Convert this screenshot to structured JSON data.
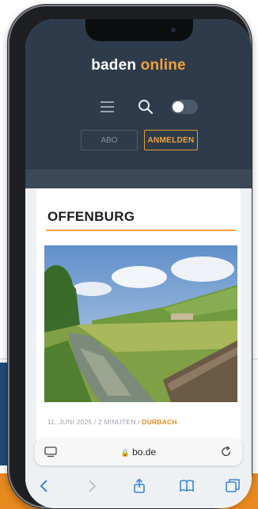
{
  "header": {
    "logo_part1": "baden",
    "logo_part2": "online",
    "abo_label": "ABO",
    "login_label": "ANMELDEN"
  },
  "section": {
    "title": "OFFENBURG"
  },
  "article": {
    "date": "11. JUNI 2025",
    "read_time": "2 MINUTEN",
    "category": "DURBACH",
    "separator": " / "
  },
  "browser": {
    "url": "bo.de"
  },
  "colors": {
    "accent": "#f2a23a",
    "header_bg": "#2d3b4a"
  },
  "icons": {
    "menu": "menu-icon",
    "search": "search-icon",
    "theme_toggle": "toggle",
    "tabs": "tabs-icon",
    "lock": "lock-icon",
    "reload": "reload-icon",
    "back": "back-icon",
    "forward": "forward-icon",
    "share": "share-icon",
    "bookmarks": "bookmarks-icon",
    "tab_overview": "tab-overview-icon"
  }
}
